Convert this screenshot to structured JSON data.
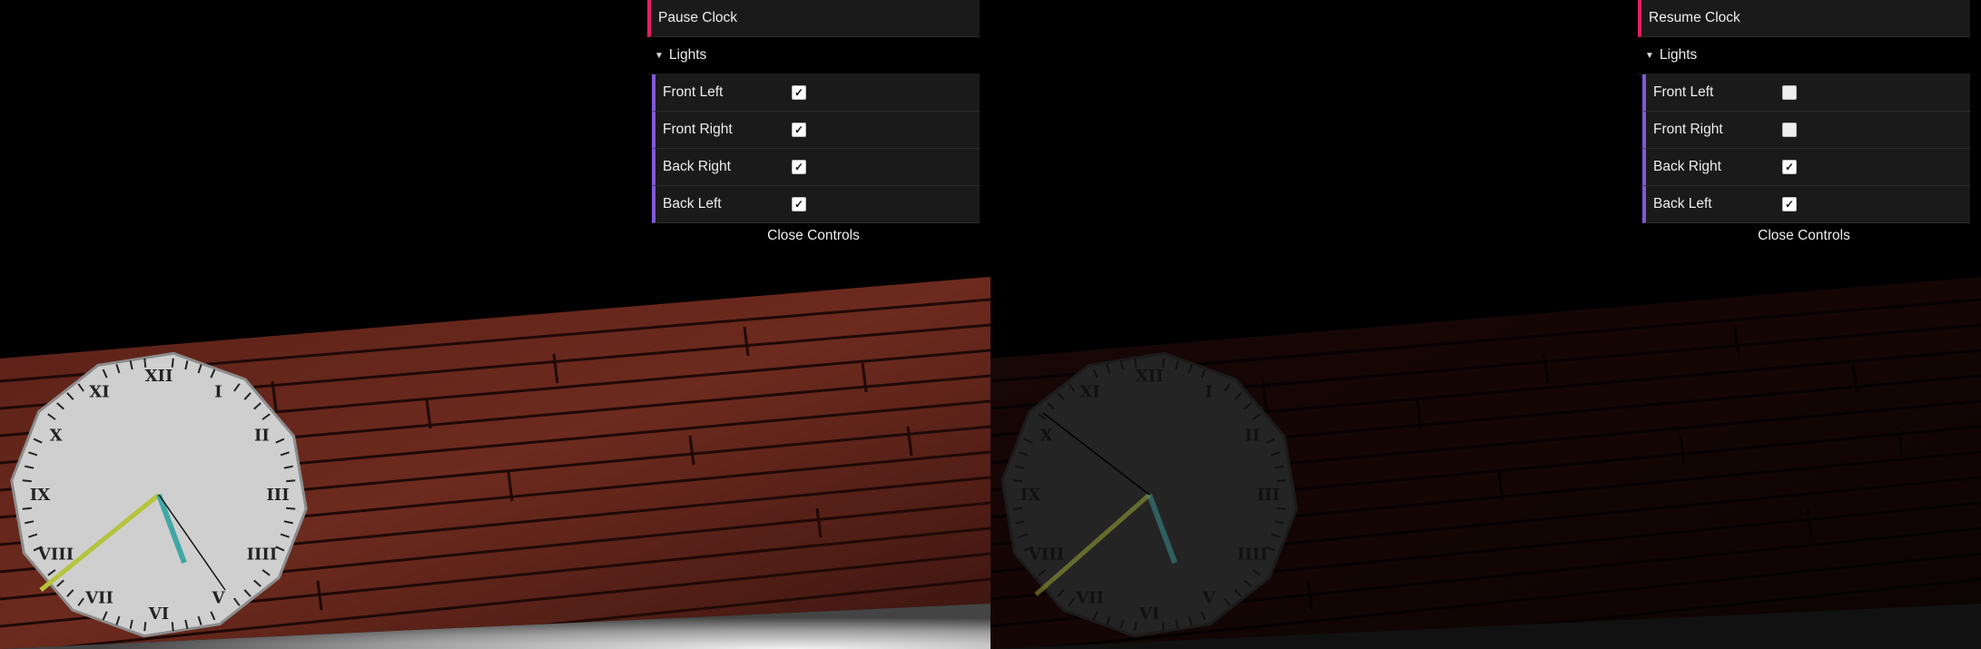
{
  "panels": [
    {
      "button_label": "Pause Clock",
      "folder_label": "Lights",
      "lights": [
        {
          "label": "Front Left",
          "checked": true
        },
        {
          "label": "Front Right",
          "checked": true
        },
        {
          "label": "Back Right",
          "checked": true
        },
        {
          "label": "Back Left",
          "checked": true
        }
      ],
      "close_label": "Close Controls"
    },
    {
      "button_label": "Resume Clock",
      "folder_label": "Lights",
      "lights": [
        {
          "label": "Front Left",
          "checked": false
        },
        {
          "label": "Front Right",
          "checked": false
        },
        {
          "label": "Back Right",
          "checked": true
        },
        {
          "label": "Back Left",
          "checked": true
        }
      ],
      "close_label": "Close Controls"
    }
  ],
  "clock_numerals": [
    "XII",
    "I",
    "II",
    "III",
    "IIII",
    "V",
    "VI",
    "VII",
    "VIII",
    "IX",
    "X",
    "XI"
  ],
  "colors": {
    "button_accent": "#e61d5f",
    "checkbox_accent": "#805ad5",
    "hour_hand": "#b5c43b",
    "minute_hand": "#3fa7a7"
  }
}
